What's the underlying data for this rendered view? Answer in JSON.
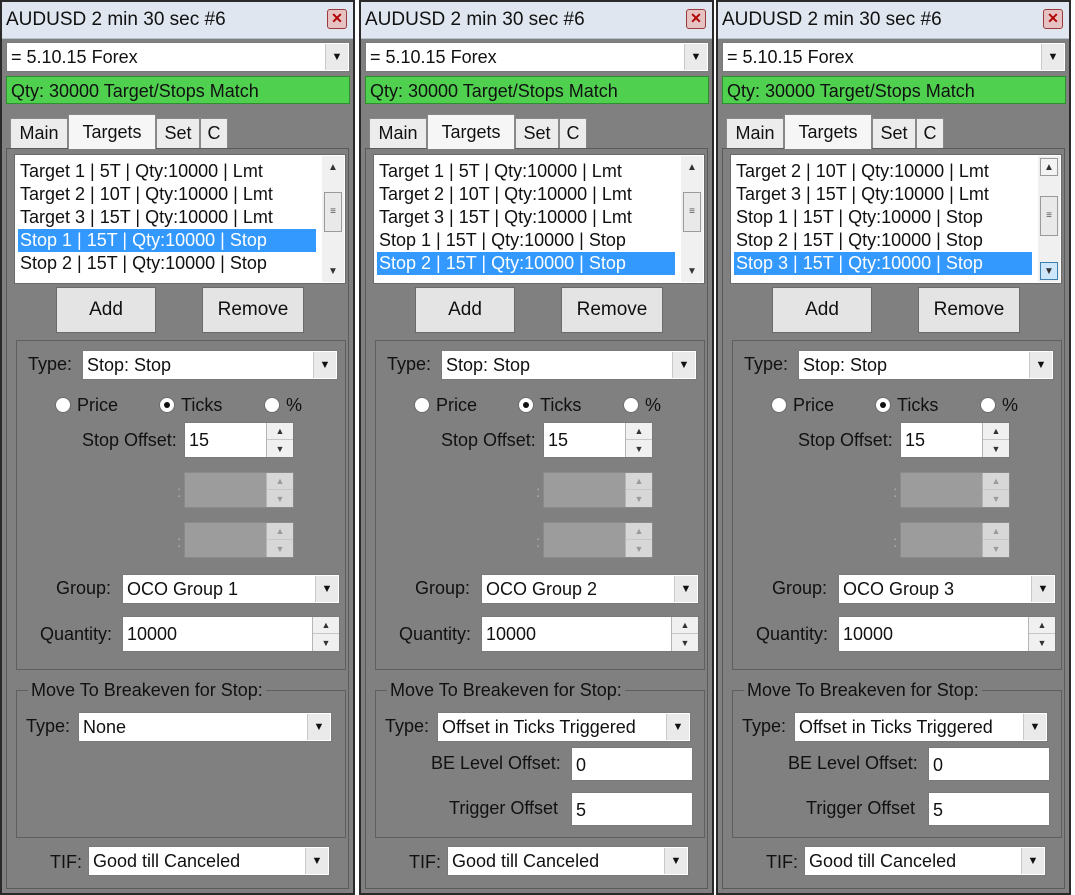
{
  "panels": [
    {
      "title": "AUDUSD  2 min 30 sec   #6",
      "strategy": "= 5.10.15 Forex",
      "status": "Qty: 30000 Target/Stops Match",
      "tabs": [
        "Main",
        "Targets",
        "Set",
        "C"
      ],
      "active_tab": "Targets",
      "list_items": [
        "Target 1 | 5T | Qty:10000 | Lmt",
        "Target 2 | 10T | Qty:10000 | Lmt",
        "Target 3 | 15T | Qty:10000 | Lmt",
        "Stop 1 | 15T | Qty:10000 | Stop",
        "Stop 2 | 15T | Qty:10000 | Stop"
      ],
      "selected_index": 3,
      "add_label": "Add",
      "remove_label": "Remove",
      "type_label": "Type:",
      "type_value": "Stop: Stop",
      "radio_labels": [
        "Price",
        "Ticks",
        "%"
      ],
      "radio_selected": 1,
      "stop_offset_label": "Stop Offset:",
      "stop_offset_value": "15",
      "group_label": "Group:",
      "group_value": "OCO Group 1",
      "quantity_label": "Quantity:",
      "quantity_value": "10000",
      "be_legend": "Move To Breakeven for Stop:",
      "be_type_label": "Type:",
      "be_type_value": "None",
      "tif_label": "TIF:",
      "tif_value": "Good till Canceled"
    },
    {
      "title": "AUDUSD  2 min 30 sec   #6",
      "strategy": "= 5.10.15 Forex",
      "status": "Qty: 30000 Target/Stops Match",
      "tabs": [
        "Main",
        "Targets",
        "Set",
        "C"
      ],
      "active_tab": "Targets",
      "list_items": [
        "Target 1 | 5T | Qty:10000 | Lmt",
        "Target 2 | 10T | Qty:10000 | Lmt",
        "Target 3 | 15T | Qty:10000 | Lmt",
        "Stop 1 | 15T | Qty:10000 | Stop",
        "Stop 2 | 15T | Qty:10000 | Stop"
      ],
      "selected_index": 4,
      "add_label": "Add",
      "remove_label": "Remove",
      "type_label": "Type:",
      "type_value": "Stop: Stop",
      "radio_labels": [
        "Price",
        "Ticks",
        "%"
      ],
      "radio_selected": 1,
      "stop_offset_label": "Stop Offset:",
      "stop_offset_value": "15",
      "group_label": "Group:",
      "group_value": "OCO Group 2",
      "quantity_label": "Quantity:",
      "quantity_value": "10000",
      "be_legend": "Move To Breakeven for Stop:",
      "be_type_label": "Type:",
      "be_type_value": "Offset in Ticks Triggered",
      "be_level_label": "BE Level Offset:",
      "be_level_value": "0",
      "trigger_label": "Trigger Offset",
      "trigger_value": "5",
      "tif_label": "TIF:",
      "tif_value": "Good till Canceled"
    },
    {
      "title": "AUDUSD  2 min 30 sec   #6",
      "strategy": "= 5.10.15 Forex",
      "status": "Qty: 30000 Target/Stops Match",
      "tabs": [
        "Main",
        "Targets",
        "Set",
        "C"
      ],
      "active_tab": "Targets",
      "list_items": [
        "Target 2 | 10T | Qty:10000 | Lmt",
        "Target 3 | 15T | Qty:10000 | Lmt",
        "Stop 1 | 15T | Qty:10000 | Stop",
        "Stop 2 | 15T | Qty:10000 | Stop",
        "Stop 3 | 15T | Qty:10000 | Stop"
      ],
      "selected_index": 4,
      "add_label": "Add",
      "remove_label": "Remove",
      "type_label": "Type:",
      "type_value": "Stop: Stop",
      "radio_labels": [
        "Price",
        "Ticks",
        "%"
      ],
      "radio_selected": 1,
      "stop_offset_label": "Stop Offset:",
      "stop_offset_value": "15",
      "group_label": "Group:",
      "group_value": "OCO Group 3",
      "quantity_label": "Quantity:",
      "quantity_value": "10000",
      "be_legend": "Move To Breakeven for Stop:",
      "be_type_label": "Type:",
      "be_type_value": "Offset in Ticks Triggered",
      "be_level_label": "BE Level Offset:",
      "be_level_value": "0",
      "trigger_label": "Trigger Offset",
      "trigger_value": "5",
      "tif_label": "TIF:",
      "tif_value": "Good till Canceled"
    }
  ],
  "icons": {
    "close": "close-icon",
    "dropdown": "chevron-down-icon",
    "spin_up": "spin-up-icon",
    "spin_down": "spin-down-icon",
    "scroll_up": "scroll-up-icon",
    "scroll_down": "scroll-down-icon"
  },
  "colors": {
    "status_ok": "#4fd14f",
    "selection": "#3399ff",
    "panel_bg": "#808080"
  }
}
